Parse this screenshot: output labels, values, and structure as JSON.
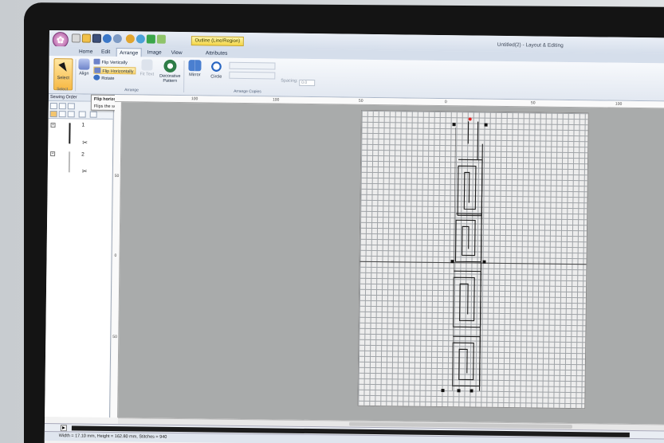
{
  "app": {
    "window_title": "Untitled(2) - Layout & Editing",
    "context_tab": "Outline (Line/Region)"
  },
  "tabs": [
    "Home",
    "Edit",
    "Arrange",
    "Image",
    "View",
    "Attributes"
  ],
  "ribbon": {
    "select_label": "Select",
    "align_label": "Align",
    "flip_vertically": "Flip Vertically",
    "flip_horizontally": "Flip Horizontally",
    "rotate": "Rotate",
    "fit_text": "Fit Text",
    "decorative_pattern": "Decorative Pattern",
    "mirror": "Mirror",
    "circle": "Circle",
    "spacing_label": "Spacing:",
    "spacing_value": "0.0",
    "group_select": "Select",
    "group_arrange": "Arrange",
    "group_arrange_copies": "Arrange Copies"
  },
  "tooltip": {
    "title": "Flip horizontally (Strg+J)",
    "body": "Flips the selected pattern(s) left/right."
  },
  "sewing_order": {
    "title": "Sewing Order",
    "items": [
      {
        "number": "1"
      },
      {
        "number": "2"
      }
    ]
  },
  "rulers": {
    "top_labels": [
      "100",
      "100",
      "50",
      "0",
      "50",
      "100"
    ],
    "left_labels": [
      "50",
      "0",
      "50"
    ]
  },
  "status": {
    "text": "Width = 17.10 mm, Height = 162.80 mm, Stitches = 940"
  },
  "colors": {
    "accent": "#f7b944",
    "ribbon": "#e2e8f1",
    "workspace": "#a9abab"
  }
}
